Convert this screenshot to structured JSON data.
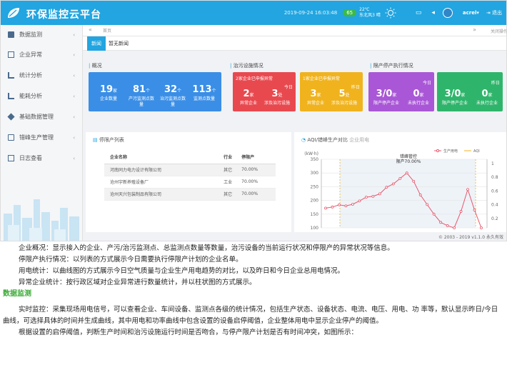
{
  "app": {
    "title": "环保监控云平台",
    "datetime": "2019-09-24  16:03:48",
    "aqi_value": "65",
    "weather_temp": "22℃",
    "weather_wind": "东北风3 晴",
    "user": "acrel",
    "logout_label": "退出"
  },
  "sidebar": {
    "items": [
      {
        "label": "数据监测",
        "icon": "monitor-icon"
      },
      {
        "label": "企业异常",
        "icon": "alert-icon"
      },
      {
        "label": "统计分析",
        "icon": "bar-chart-icon"
      },
      {
        "label": "能耗分析",
        "icon": "energy-icon"
      },
      {
        "label": "基础数据管理",
        "icon": "database-icon"
      },
      {
        "label": "错峰生产管理",
        "icon": "schedule-icon"
      },
      {
        "label": "日志查看",
        "icon": "log-icon"
      }
    ]
  },
  "tabs": {
    "home": "首页",
    "close_ops": "关闭操作"
  },
  "news": {
    "label": "新闻",
    "text": "暂无新闻"
  },
  "overview": {
    "title": "概况",
    "stats": [
      {
        "value": "19",
        "unit": "家",
        "label": "企业数量"
      },
      {
        "value": "81",
        "unit": "个",
        "label": "产污监测点数量"
      },
      {
        "value": "32",
        "unit": "个",
        "label": "治污监测点数量"
      },
      {
        "value": "113",
        "unit": "个",
        "label": "监测点数量"
      }
    ]
  },
  "pollution_control": {
    "title": "治污设施情况",
    "cards": [
      {
        "header": "2家企业已申报异常",
        "day": "今日",
        "stats": [
          {
            "value": "2",
            "unit": "家",
            "label": "异常企业"
          },
          {
            "value": "3",
            "unit": "处",
            "label": "涉及治污设施"
          }
        ]
      },
      {
        "header": "1家企业已申报异常",
        "day": "昨日",
        "stats": [
          {
            "value": "3",
            "unit": "家",
            "label": "异常企业"
          },
          {
            "value": "5",
            "unit": "处",
            "label": "涉及治污设施"
          }
        ]
      }
    ]
  },
  "restriction": {
    "title": "限产停产执行情况",
    "cards": [
      {
        "day": "今日",
        "stats": [
          {
            "value": "3/0",
            "unit": "家",
            "label": "限产停产企业"
          },
          {
            "value": "0",
            "unit": "家",
            "label": "未执行企业"
          }
        ]
      },
      {
        "day": "昨日",
        "stats": [
          {
            "value": "3/0",
            "unit": "家",
            "label": "限产停产企业"
          },
          {
            "value": "0",
            "unit": "家",
            "label": "未执行企业"
          }
        ]
      }
    ]
  },
  "stop_list": {
    "title": "停限产列表",
    "headers": [
      "企业名称",
      "行业",
      "停限产"
    ],
    "rows": [
      [
        "河南同力电力设计有限公司",
        "其它",
        "70.00%"
      ],
      [
        "沧州宇新养殖设备厂",
        "工业",
        "70.00%"
      ],
      [
        "沧州天兴包装制品有限公司",
        "其它",
        "70.00%"
      ]
    ]
  },
  "chart_data": {
    "type": "line",
    "title": "AQI/错峰生产对比",
    "subtitle": "企业用电",
    "ylabel": "(kW·h)",
    "legend": [
      "生产用电",
      "AQI"
    ],
    "annotation": "错峰管控\n限产70.00%",
    "yticks_left": [
      "350",
      "300",
      "250",
      "200",
      "150",
      "100"
    ],
    "yticks_right": [
      "1",
      "0.8",
      "0.6",
      "0.4",
      "0.2"
    ],
    "ylim": [
      100,
      350
    ],
    "series": [
      {
        "name": "生产用电",
        "values": [
          172,
          176,
          184,
          180,
          186,
          198,
          212,
          215,
          224,
          248,
          260,
          280,
          300,
          270,
          220,
          185,
          150,
          120,
          108,
          100,
          160,
          240,
          165,
          100
        ]
      }
    ]
  },
  "footer": "© 2003 - 2019  v1.1.0  永久有效",
  "doc": {
    "lines": [
      "企业概况：显示接入的企业、产污/治污监测点、总监测点数量等数量，治污设备的当前运行状况和停限产的异常状况等信息。",
      "停限产执行情况：以列表的方式展示今日需要执行停限产计划的企业名单。",
      "用电统计：以曲线图的方式展示今日空气质量与企业生产用电趋势的对比，以及昨日和今日企业总用电情况。",
      "异常企业统计：按行政区域对企业异常进行数量统计，并以柱状图的方式展示。"
    ],
    "heading": "数据监测",
    "para1": "实时监控：采集现场用电信号，可以查看企业、车间设备、监测点各级的统计情况，包括生产状态、设备状态、电流、电压、用电、功 率等，默认显示昨日/今日曲线，可选择具体的时间并生成曲线，其中用电和功率曲线中包含设置的设备启停阈值，企业整体用电中显示企业停产的阈值。",
    "para2": "根据设置的启停阈值，判断生产时间和治污设施运行时间是否吻合，与停产限产计划是否有时间冲突，如图所示："
  },
  "colors": {
    "brand": "#22a5e0",
    "card_blue": "#3a8ee6",
    "card_red": "#e8494f",
    "card_yellow": "#f0b31e",
    "card_purple": "#a957d6",
    "card_green": "#2fb56b",
    "heading_green": "#3aaa35",
    "line_red": "#e8566b"
  }
}
